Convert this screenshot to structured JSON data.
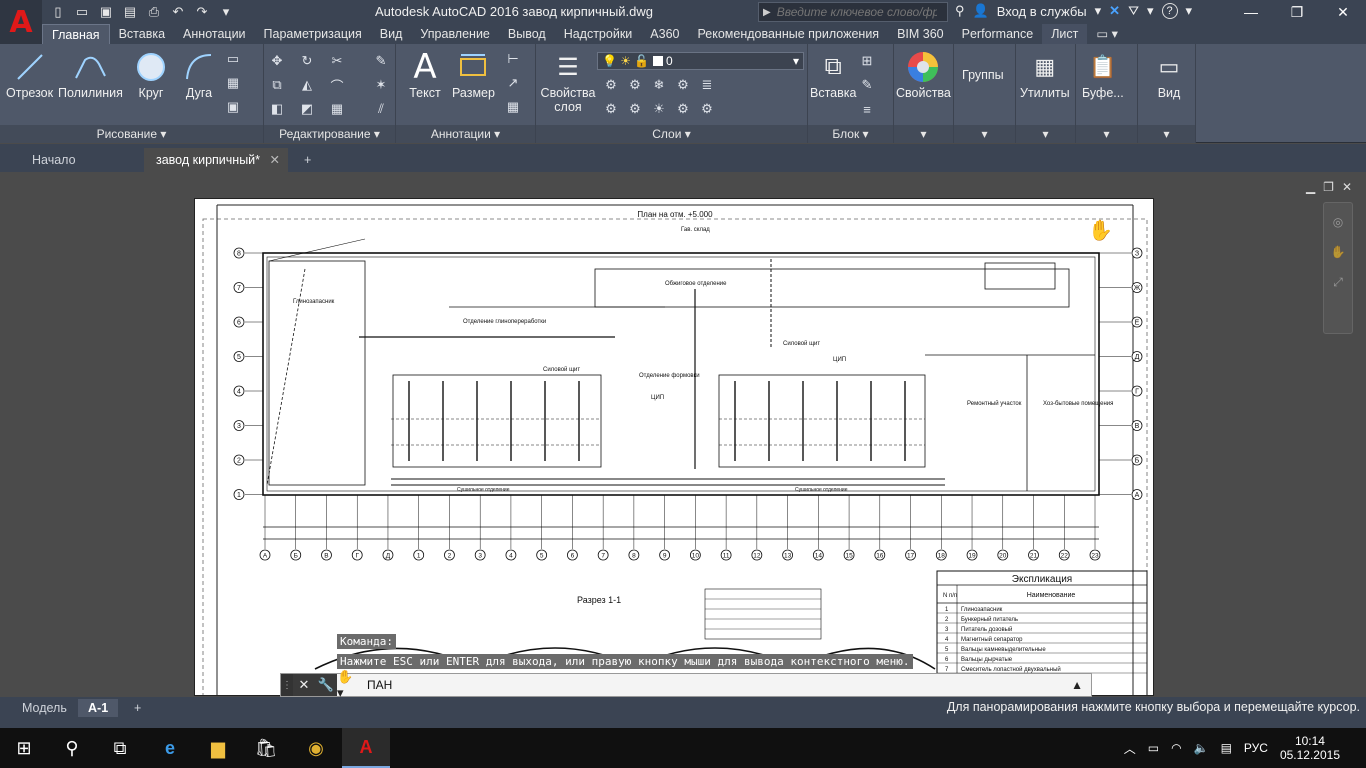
{
  "app": {
    "title": "Autodesk AutoCAD 2016   завод кирпичный.dwg",
    "logo_letter": "A",
    "search_placeholder": "Введите ключевое слово/фразу",
    "signin_label": "Вход в службы",
    "help_label": "?"
  },
  "ribbon_tabs": [
    "Главная",
    "Вставка",
    "Аннотации",
    "Параметризация",
    "Вид",
    "Управление",
    "Вывод",
    "Надстройки",
    "A360",
    "Рекомендованные приложения",
    "BIM 360",
    "Performance",
    "Лист"
  ],
  "ribbon": {
    "draw": {
      "title": "Рисование",
      "line": "Отрезок",
      "polyline": "Полилиния",
      "circle": "Круг",
      "arc": "Дуга"
    },
    "modify": {
      "title": "Редактирование"
    },
    "annotation": {
      "title": "Аннотации",
      "text": "Текст",
      "dimension": "Размер"
    },
    "layers": {
      "title": "Слои",
      "layer_props": "Свойства слоя",
      "current_layer": "0"
    },
    "block": {
      "title": "Блок",
      "insert": "Вставка"
    },
    "properties": "Свойства",
    "groups": "Группы",
    "utilities": "Утилиты",
    "clipboard": "Буфе...",
    "view": "Вид"
  },
  "file_tabs": {
    "start": "Начало",
    "drawing": "завод кирпичный*"
  },
  "drawing": {
    "plan_title": "План на отм. +5.000",
    "section_title": "Разрез 1-1",
    "legend_title": "Экспликация",
    "legend_col_num": "N п/п",
    "legend_col_name": "Наименование",
    "labels": [
      "Глинозапасник",
      "Отделение глинопереработки",
      "Силовой щит",
      "Отделение формовки",
      "ЦИП",
      "Сушильное отделение",
      "Обжиговое отделение",
      "Ремонтный участок",
      "Хоз-бытовые помещения",
      "Гав. склад"
    ],
    "row_axes": [
      "8",
      "7",
      "6",
      "5",
      "4",
      "3",
      "2",
      "1"
    ],
    "row_axes_right": [
      "З",
      "Ж",
      "Е",
      "Д",
      "Г",
      "В",
      "Б",
      "А"
    ],
    "col_axes": [
      "А",
      "Б",
      "В",
      "Г",
      "Д",
      "1",
      "2",
      "3",
      "4",
      "5",
      "6",
      "7",
      "8",
      "9",
      "10",
      "11",
      "12",
      "13",
      "14",
      "15",
      "16",
      "17",
      "18",
      "19",
      "20",
      "21",
      "22",
      "23"
    ],
    "legend_rows": [
      [
        "1",
        "Глинозапасник"
      ],
      [
        "2",
        "Бункерный питатель"
      ],
      [
        "3",
        "Питатель дозовый"
      ],
      [
        "4",
        "Магнитный сепаратор"
      ],
      [
        "5",
        "Вальцы камневыделительные"
      ],
      [
        "6",
        "Вальцы дырчатые"
      ],
      [
        "7",
        "Смеситель лопастной двухвальный"
      ]
    ]
  },
  "command": {
    "history1": "Команда:",
    "history2": "Нажмите ESC или ENTER для выхода, или правую кнопку мыши для вывода контекстного меню.",
    "current": "ПАН"
  },
  "layout_tabs": {
    "model": "Модель",
    "sheet": "A-1"
  },
  "status_message": "Для панорамирования нажмите кнопку выбора и перемещайте курсор.",
  "taskbar": {
    "lang": "РУС",
    "time": "10:14",
    "date": "05.12.2015"
  }
}
